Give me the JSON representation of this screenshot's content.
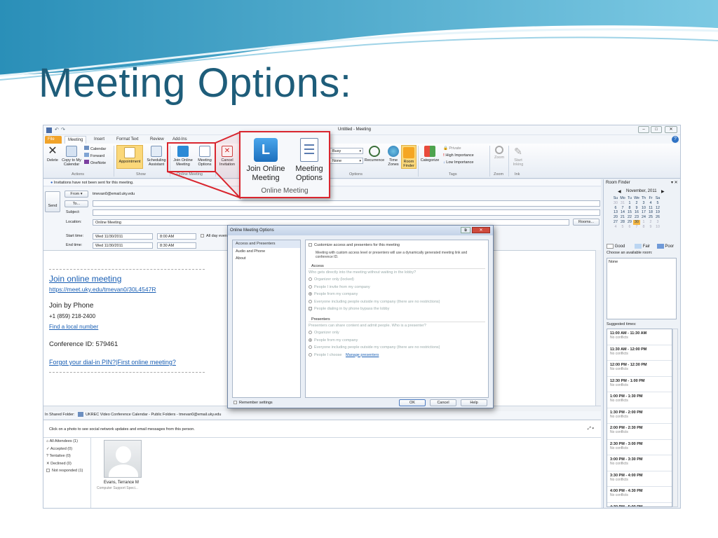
{
  "slide": {
    "title": "Meeting Options:"
  },
  "window": {
    "title": "Untitled - Meeting"
  },
  "tabs": [
    "File",
    "Meeting",
    "Insert",
    "Format Text",
    "Review",
    "Add-Ins"
  ],
  "ribbon": {
    "delete": "Delete",
    "copy": "Copy to My Calendar",
    "calendar": "Calendar",
    "forward": "Forward",
    "onenote": "OneNote",
    "actions_group": "Actions",
    "appointment": "Appointment",
    "scheduling": "Scheduling Assistant",
    "show_group": "Show",
    "join": "Join Online Meeting",
    "meeting_options": "Meeting Options",
    "online_group": "Online Meeting",
    "cancel": "Cancel Invitation",
    "busy": "Busy",
    "none": "None",
    "recurrence": "Recurrence",
    "timezones": "Time Zones",
    "roomfinder": "Room Finder",
    "options_group": "Options",
    "categorize": "Categorize",
    "private": "Private",
    "high": "High Importance",
    "low": "Low Importance",
    "tags_group": "Tags",
    "zoom": "Zoom",
    "zoom_group": "Zoom",
    "ink": "Start Inking",
    "ink_group": "Ink"
  },
  "callout": {
    "join": "Join Online Meeting",
    "options": "Meeting Options",
    "group": "Online Meeting"
  },
  "info": "Invitations have not been sent for this meeting.",
  "form": {
    "send": "Send",
    "from_btn": "From",
    "from_value": "tmevan0@email.uky.edu",
    "to_btn": "To...",
    "subject": "Subject:",
    "location": "Location:",
    "location_value": "Online Meeting",
    "rooms": "Rooms...",
    "start_label": "Start time:",
    "start_date": "Wed 11/30/2011",
    "start_time": "8:00 AM",
    "allday": "All day event",
    "end_label": "End time:",
    "end_date": "Wed 11/30/2011",
    "end_time": "8:30 AM"
  },
  "body": {
    "join_link": "Join online meeting",
    "join_url": "https://meet.uky.edu/tmevan0/30L4547R",
    "phone_heading": "Join by Phone",
    "phone": "+1 (859) 218-2400",
    "find_local": "Find a local number",
    "conference": "Conference ID: 579461",
    "forgot": "Forgot your dial-in PIN?",
    "first": "|First online meeting?"
  },
  "shared": {
    "prefix": "In Shared Folder:",
    "value": "UKREC Video Conference Calendar - Public Folders - tmevan0@email.uky.edu"
  },
  "social": {
    "hint": "Click on a photo to see social network updates and email messages from this person.",
    "filters": [
      "All Attendees (1)",
      "Accepted (0)",
      "Tentative (0)",
      "Declined (0)",
      "Not responded (1)"
    ],
    "person": "Evans, Terrance M",
    "role": "Computer Support Speci..."
  },
  "room_finder": {
    "title": "Room Finder",
    "month": "November, 2011",
    "weekdays": [
      "Su",
      "Mo",
      "Tu",
      "We",
      "Th",
      "Fr",
      "Sa"
    ],
    "weeks": [
      [
        "30",
        "31",
        "1",
        "2",
        "3",
        "4",
        "5"
      ],
      [
        "6",
        "7",
        "8",
        "9",
        "10",
        "11",
        "12"
      ],
      [
        "13",
        "14",
        "15",
        "16",
        "17",
        "18",
        "19"
      ],
      [
        "20",
        "21",
        "22",
        "23",
        "24",
        "25",
        "26"
      ],
      [
        "27",
        "28",
        "29",
        "30",
        "1",
        "2",
        "3"
      ],
      [
        "4",
        "5",
        "6",
        "7",
        "8",
        "9",
        "10"
      ]
    ],
    "legend": [
      "Good",
      "Fair",
      "Poor"
    ],
    "choose": "Choose an available room:",
    "room_value": "None",
    "suggested": "Suggested times:",
    "slots": [
      {
        "time": "11:00 AM - 11:30 AM",
        "status": "No conflicts"
      },
      {
        "time": "11:30 AM - 12:00 PM",
        "status": "No conflicts"
      },
      {
        "time": "12:00 PM - 12:30 PM",
        "status": "No conflicts"
      },
      {
        "time": "12:30 PM - 1:00 PM",
        "status": "No conflicts"
      },
      {
        "time": "1:00 PM - 1:30 PM",
        "status": "No conflicts"
      },
      {
        "time": "1:30 PM - 2:00 PM",
        "status": "No conflicts"
      },
      {
        "time": "2:00 PM - 2:30 PM",
        "status": "No conflicts"
      },
      {
        "time": "2:30 PM - 3:00 PM",
        "status": "No conflicts"
      },
      {
        "time": "3:00 PM - 3:30 PM",
        "status": "No conflicts"
      },
      {
        "time": "3:30 PM - 4:00 PM",
        "status": "No conflicts"
      },
      {
        "time": "4:00 PM - 4:30 PM",
        "status": "No conflicts"
      },
      {
        "time": "4:30 PM - 5:00 PM",
        "status": ""
      }
    ]
  },
  "dialog": {
    "title": "Online Meeting Options",
    "nav": [
      "Access and Presenters",
      "Audio and Phone",
      "About"
    ],
    "customize": "Customize access and presenters for this meeting",
    "note": "Meeting with custom access level or presenters will use a dynamically generated meeting link and conference ID.",
    "access_heading": "Access",
    "access_question": "Who gets directly into the meeting without waiting in the lobby?",
    "access_opts": [
      "Organizer only (locked)",
      "People I invite from my company",
      "People from my company",
      "Everyone including people outside my company (there are no restrictions)"
    ],
    "phone_bypass": "People dialing in by phone bypass the lobby",
    "presenters_heading": "Presenters",
    "presenters_question": "Presenters can share content and admit people. Who is a presenter?",
    "presenter_opts": [
      "Organizer only",
      "People from my company",
      "Everyone including people outside my company (there are no restrictions)",
      "People I choose"
    ],
    "manage": "Manage presenters",
    "remember": "Remember settings",
    "ok": "OK",
    "cancel": "Cancel",
    "help": "Help"
  },
  "colors": {
    "title": "#1e5d7a",
    "accent_red": "#d9262f",
    "file_tab": "#f1a32a",
    "link": "#1a5fb4"
  }
}
